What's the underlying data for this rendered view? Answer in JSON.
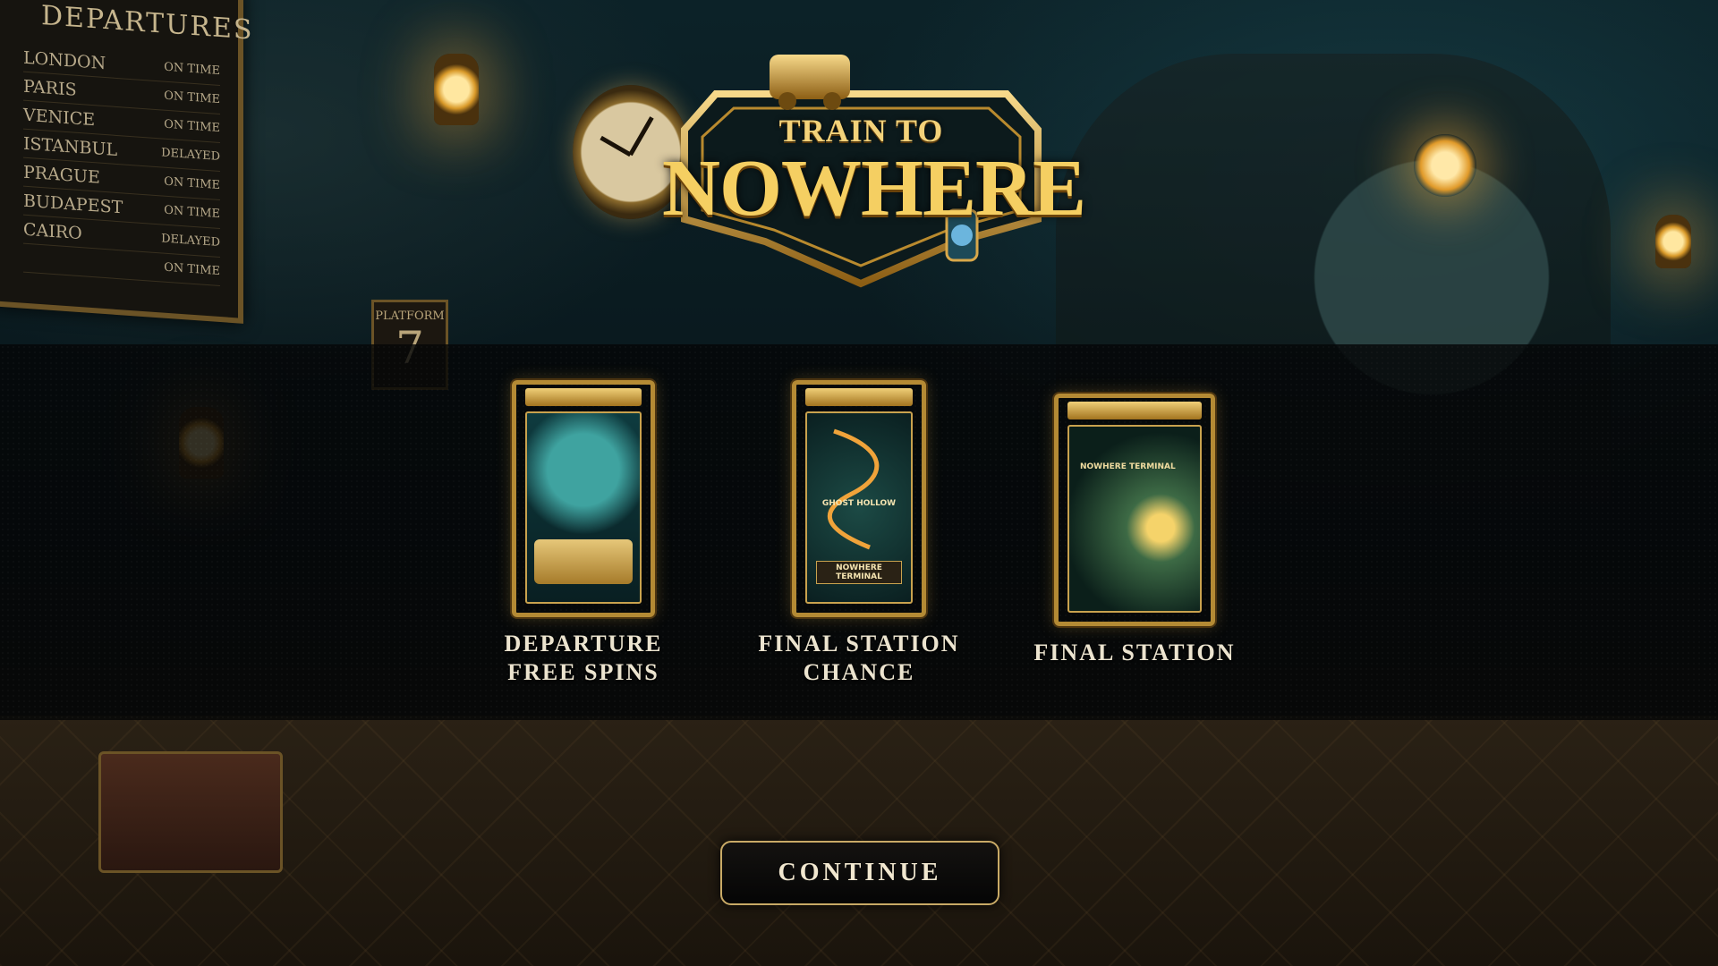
{
  "game": {
    "logo_line1": "TRAIN TO",
    "logo_line2": "NOWHERE"
  },
  "departures_board": {
    "title": "DEPARTURES",
    "rows": [
      {
        "city": "LONDON",
        "status": "ON TIME"
      },
      {
        "city": "PARIS",
        "status": "ON TIME"
      },
      {
        "city": "VENICE",
        "status": "ON TIME"
      },
      {
        "city": "ISTANBUL",
        "status": "DELAYED"
      },
      {
        "city": "PRAGUE",
        "status": "ON TIME"
      },
      {
        "city": "BUDAPEST",
        "status": "ON TIME"
      },
      {
        "city": "CAIRO",
        "status": "DELAYED"
      },
      {
        "city": "",
        "status": "ON TIME"
      }
    ]
  },
  "platform_sign": {
    "label": "PLATFORM",
    "number": "7"
  },
  "features": [
    {
      "line1": "DEPARTURE",
      "line2": "FREE SPINS",
      "art_text": ""
    },
    {
      "line1": "FINAL STATION",
      "line2": "CHANCE",
      "art_text": "GHOST HOLLOW",
      "art_text2": "NOWHERE TERMINAL"
    },
    {
      "line1": "FINAL STATION",
      "line2": "",
      "art_text": "NOWHERE TERMINAL"
    }
  ],
  "continue_label": "CONTINUE",
  "colors": {
    "gold": "#b48a34",
    "band": "#050607",
    "text": "#ece4cf"
  }
}
